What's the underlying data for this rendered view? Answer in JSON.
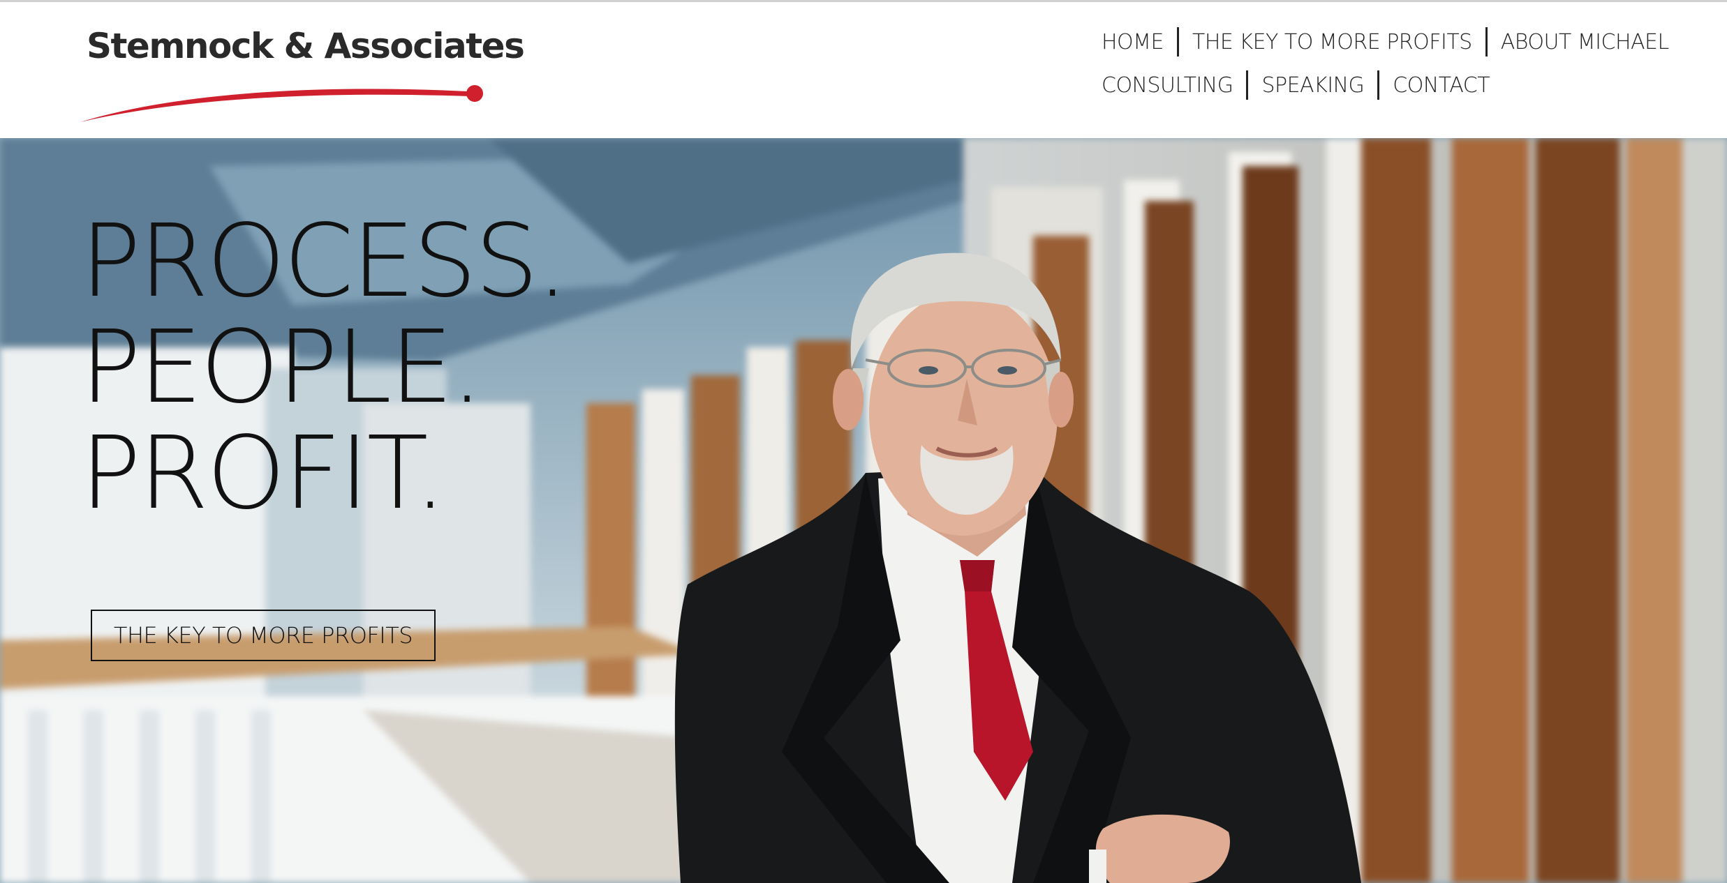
{
  "brand": {
    "name": "Stemnock & Associates",
    "accent_color": "#d0202e"
  },
  "nav": {
    "row1": [
      "HOME",
      "THE KEY TO MORE PROFITS",
      "ABOUT MICHAEL"
    ],
    "row2": [
      "CONSULTING",
      "SPEAKING",
      "CONTACT"
    ]
  },
  "hero": {
    "headline": [
      "PROCESS.",
      "PEOPLE.",
      "PROFIT."
    ],
    "cta_label": "THE KEY TO MORE PROFITS",
    "image": "portrait of a man in a dark suit with red tie"
  }
}
